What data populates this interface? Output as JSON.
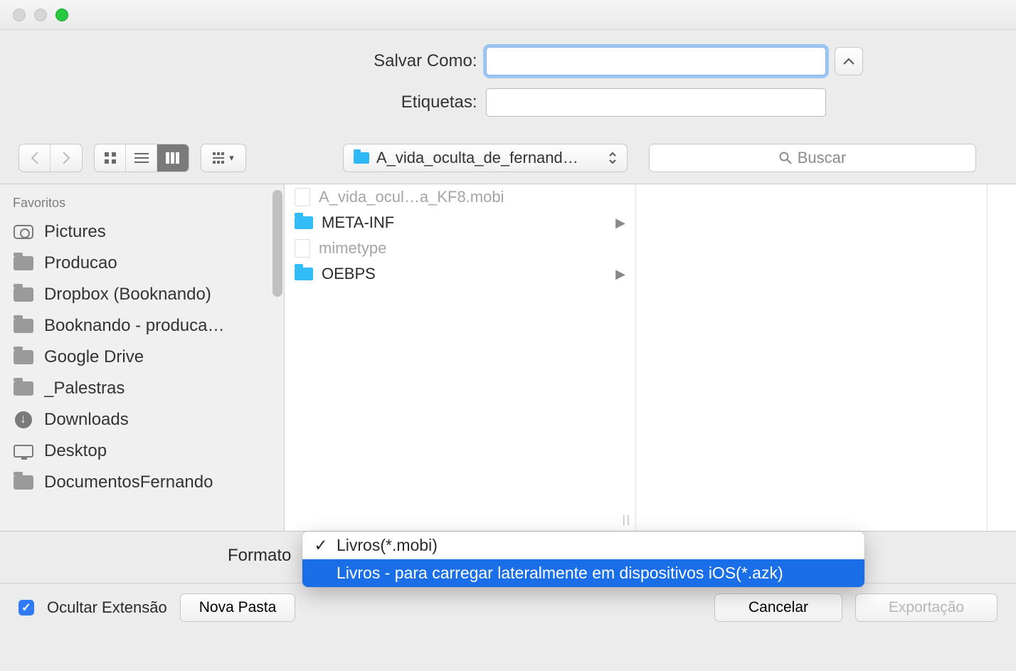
{
  "formRow": {
    "saveAsLabel": "Salvar Como:",
    "saveAsValue": "",
    "tagsLabel": "Etiquetas:",
    "tagsValue": ""
  },
  "toolbar": {
    "locationName": "A_vida_oculta_de_fernand…",
    "searchPlaceholder": "Buscar"
  },
  "sidebar": {
    "header": "Favoritos",
    "items": [
      {
        "label": "Pictures",
        "icon": "camera"
      },
      {
        "label": "Producao",
        "icon": "folder"
      },
      {
        "label": "Dropbox (Booknando)",
        "icon": "folder"
      },
      {
        "label": "Booknando - produca…",
        "icon": "folder"
      },
      {
        "label": "Google Drive",
        "icon": "folder"
      },
      {
        "label": "_Palestras",
        "icon": "folder"
      },
      {
        "label": "Downloads",
        "icon": "download"
      },
      {
        "label": "Desktop",
        "icon": "desktop"
      },
      {
        "label": "DocumentosFernando",
        "icon": "folder"
      }
    ]
  },
  "column1": [
    {
      "label": "A_vida_ocul…a_KF8.mobi",
      "type": "file",
      "dim": true
    },
    {
      "label": "META-INF",
      "type": "folder",
      "arrow": true
    },
    {
      "label": "mimetype",
      "type": "file",
      "dim": true
    },
    {
      "label": "OEBPS",
      "type": "folder",
      "arrow": true
    }
  ],
  "format": {
    "label": "Formato",
    "options": [
      {
        "label": "Livros(*.mobi)",
        "checked": true,
        "selected": false
      },
      {
        "label": "Livros - para carregar lateralmente em dispositivos iOS(*.azk)",
        "checked": false,
        "selected": true
      }
    ]
  },
  "bottom": {
    "hideExtLabel": "Ocultar Extensão",
    "hideExtChecked": true,
    "newFolderLabel": "Nova Pasta",
    "cancelLabel": "Cancelar",
    "exportLabel": "Exportação"
  }
}
